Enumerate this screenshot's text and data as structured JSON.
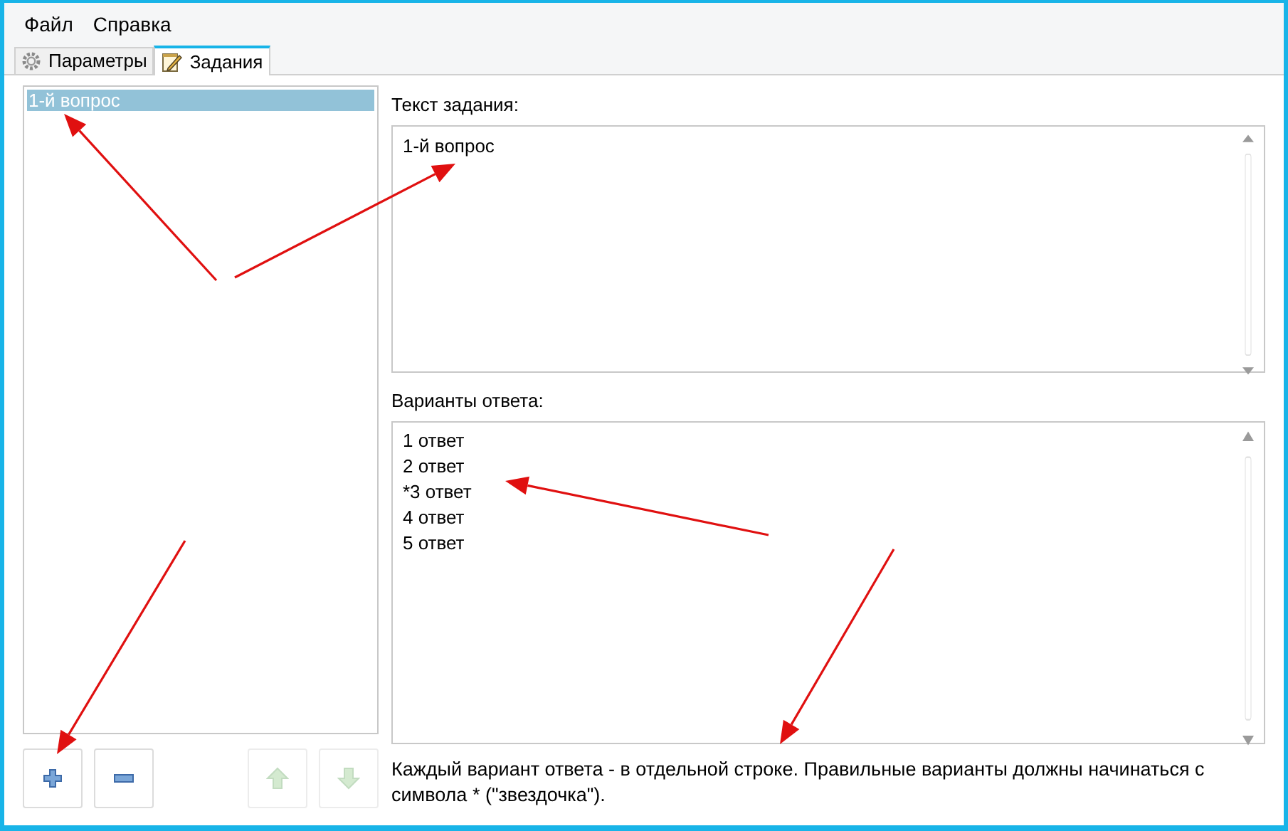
{
  "menu": [
    "Файл",
    "Справка"
  ],
  "tabs": [
    {
      "label": "Параметры",
      "selected": false,
      "kind": "settings"
    },
    {
      "label": "Задания",
      "selected": true,
      "kind": "tasks"
    }
  ],
  "questions": [
    {
      "text": "1-й вопрос",
      "selected": true
    }
  ],
  "task_text": {
    "label": "Текст задания:",
    "value": "1-й вопрос"
  },
  "answers": {
    "label": "Варианты ответа:",
    "lines": [
      "1 ответ",
      "2 ответ",
      "*3 ответ",
      "4 ответ",
      "5 ответ"
    ]
  },
  "buttons": [
    {
      "kind": "add",
      "disabled": false
    },
    {
      "kind": "remove",
      "disabled": false
    },
    {
      "kind": "up",
      "disabled": true
    },
    {
      "kind": "down",
      "disabled": true
    }
  ],
  "hint": "Каждый вариант ответа - в отдельной строке. Правильные варианты должны начинаться с символа * (\"звездочка\")."
}
